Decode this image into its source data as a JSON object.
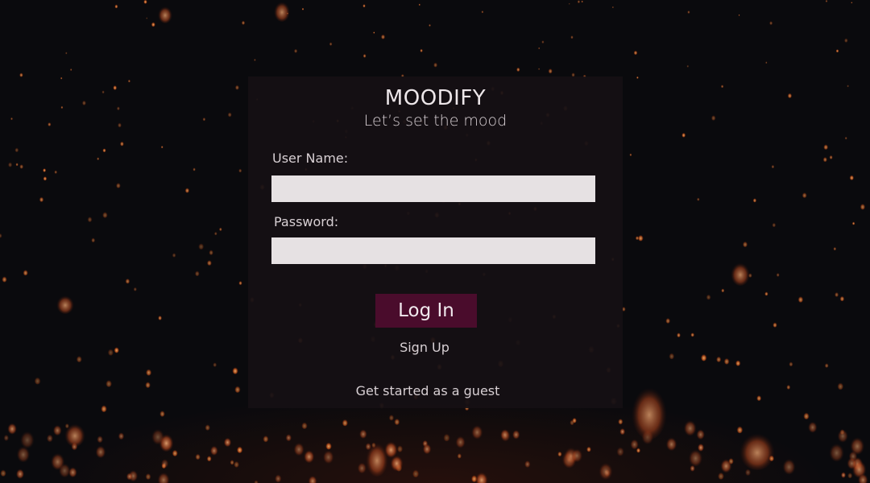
{
  "app": {
    "title": "MOODIFY",
    "tagline": "Let’s set the mood"
  },
  "form": {
    "username_label": "User Name:",
    "username_value": "",
    "password_label": "Password:",
    "password_value": "",
    "login_label": "Log In",
    "signup_label": "Sign Up",
    "guest_label": "Get started as a guest"
  },
  "colors": {
    "background": "#0a0a0d",
    "card": "#161014",
    "input": "#e6e1e3",
    "button": "#4a0c2c",
    "text": "#d8d0d4",
    "lantern": "#ff8a3a"
  }
}
